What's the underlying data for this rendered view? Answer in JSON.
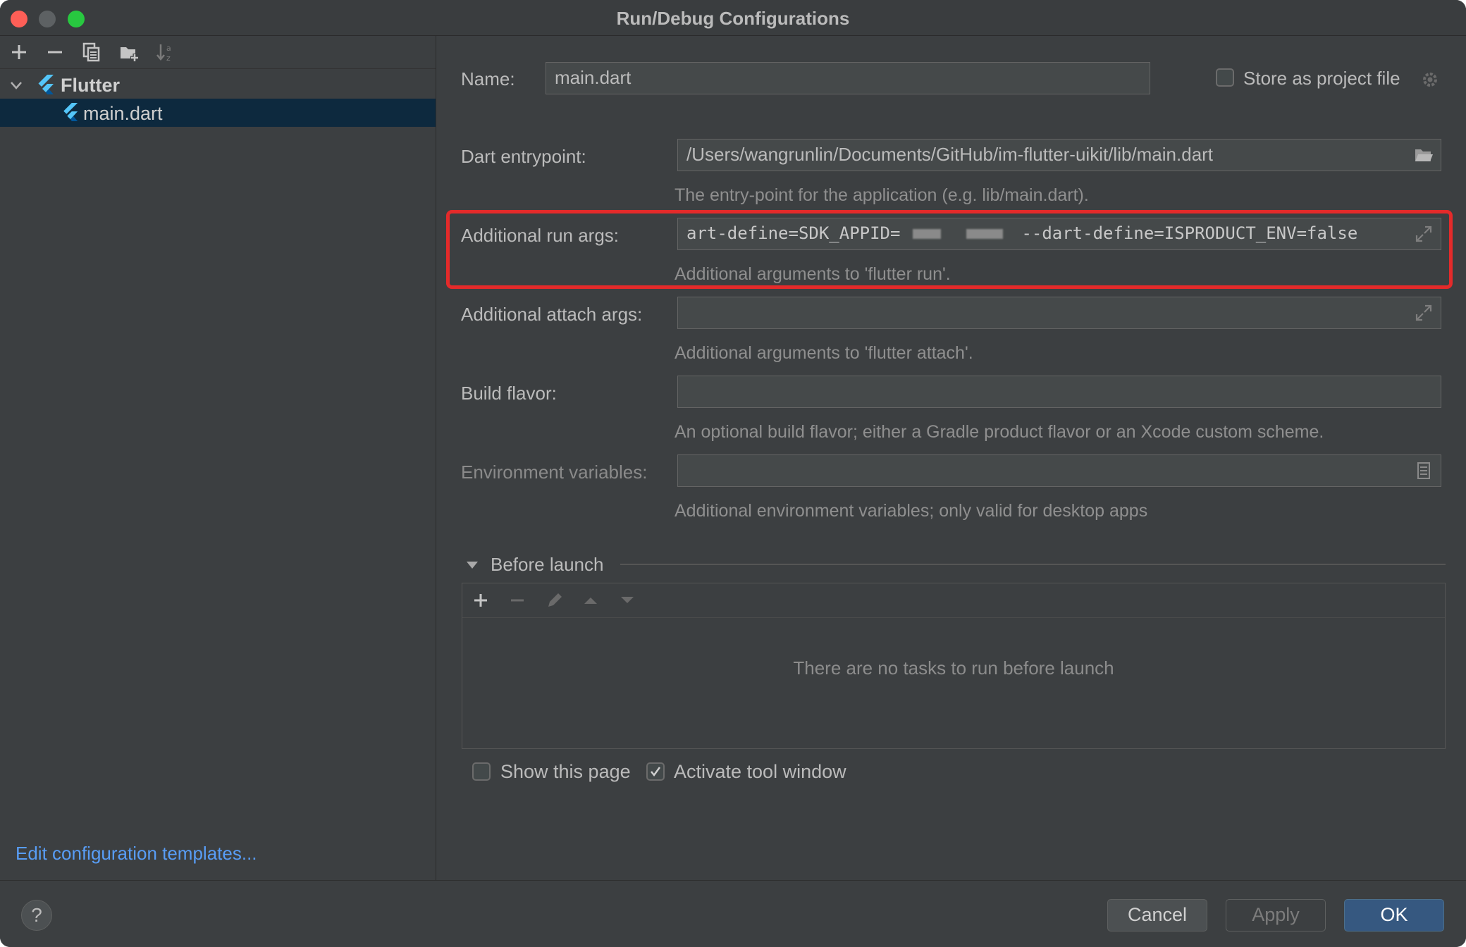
{
  "window": {
    "title": "Run/Debug Configurations"
  },
  "tree": {
    "group_label": "Flutter",
    "item_label": "main.dart"
  },
  "left": {
    "edit_templates_link": "Edit configuration templates..."
  },
  "form": {
    "name_label": "Name:",
    "name_value": "main.dart",
    "store_label": "Store as project file",
    "entry_label": "Dart entrypoint:",
    "entry_value": "/Users/wangrunlin/Documents/GitHub/im-flutter-uikit/lib/main.dart",
    "entry_hint": "The entry-point for the application (e.g. lib/main.dart).",
    "run_args_label": "Additional run args:",
    "run_args_value_a": "art-define=SDK_APPID=",
    "run_args_value_b": "--dart-define=ISPRODUCT_ENV=false",
    "run_args_hint": "Additional arguments to 'flutter run'.",
    "attach_label": "Additional attach args:",
    "attach_value": "",
    "attach_hint": "Additional arguments to 'flutter attach'.",
    "flavor_label": "Build flavor:",
    "flavor_value": "",
    "flavor_hint": "An optional build flavor; either a Gradle product flavor or an Xcode custom scheme.",
    "env_label": "Environment variables:",
    "env_value": "",
    "env_hint": "Additional environment variables; only valid for desktop apps"
  },
  "before_launch": {
    "title": "Before launch",
    "empty_message": "There are no tasks to run before launch",
    "show_page_label": "Show this page",
    "activate_label": "Activate tool window"
  },
  "buttons": {
    "help": "?",
    "cancel": "Cancel",
    "apply": "Apply",
    "ok": "OK"
  },
  "colors": {
    "highlight": "#e42a2a",
    "link": "#589df6",
    "selection": "#0d293e",
    "primary": "#365880"
  }
}
